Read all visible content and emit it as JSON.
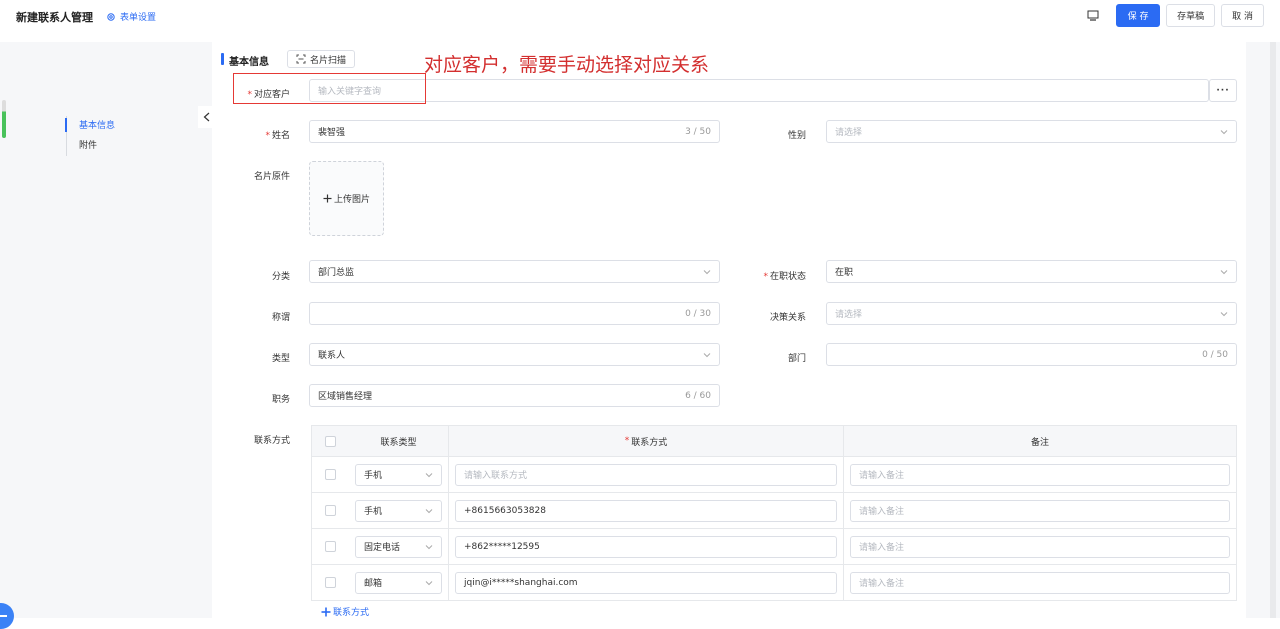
{
  "header": {
    "title": "新建联系人管理",
    "settings_label": "表单设置",
    "save_label": "保 存",
    "draft_label": "存草稿",
    "cancel_label": "取 消"
  },
  "side_nav": {
    "items": [
      {
        "label": "基本信息",
        "active": true
      },
      {
        "label": "附件",
        "active": false
      }
    ]
  },
  "section": {
    "title": "基本信息",
    "scan_label": "名片扫描"
  },
  "annotation": {
    "text": "对应客户，需要手动选择对应关系"
  },
  "form": {
    "customer": {
      "label": "对应客户",
      "required": true,
      "placeholder": "输入关键字查询",
      "more": "···"
    },
    "name": {
      "label": "姓名",
      "required": true,
      "value": "裴智强",
      "count": "3 / 50"
    },
    "gender": {
      "label": "性别",
      "placeholder": "请选择"
    },
    "card": {
      "label": "名片原件",
      "upload_label": "上传图片"
    },
    "category": {
      "label": "分类",
      "value": "部门总监"
    },
    "status": {
      "label": "在职状态",
      "required": true,
      "value": "在职"
    },
    "salutation": {
      "label": "称谓",
      "count": "0 / 30"
    },
    "decision": {
      "label": "决策关系",
      "placeholder": "请选择"
    },
    "type": {
      "label": "类型",
      "value": "联系人"
    },
    "department": {
      "label": "部门",
      "count": "0 / 50"
    },
    "position": {
      "label": "职务",
      "value": "区域销售经理",
      "count": "6 / 60"
    },
    "contacts_label": "联系方式"
  },
  "contact_table": {
    "headers": {
      "type": "联系类型",
      "way": "联系方式",
      "note": "备注"
    },
    "note_placeholder": "请输入备注",
    "way_placeholder": "请输入联系方式",
    "rows": [
      {
        "type": "手机",
        "value": ""
      },
      {
        "type": "手机",
        "value": "+8615663053828"
      },
      {
        "type": "固定电话",
        "value": "+862*****12595"
      },
      {
        "type": "邮箱",
        "value": "jqin@i*****shanghai.com"
      }
    ],
    "add_label": "联系方式"
  },
  "colors": {
    "primary": "#2b6bf3",
    "required": "#e53935",
    "annotation": "#d32f2f"
  }
}
